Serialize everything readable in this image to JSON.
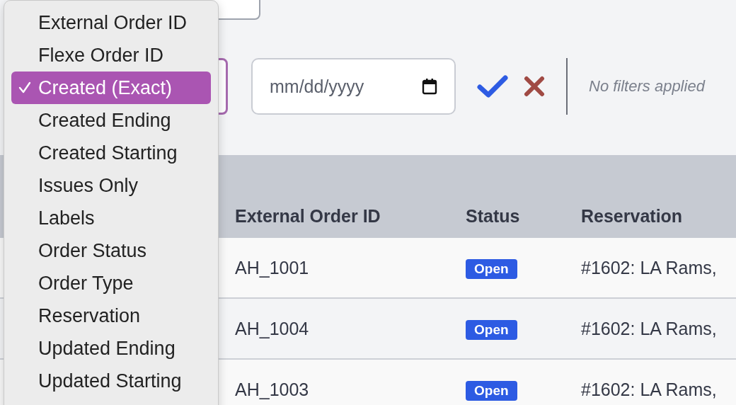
{
  "filter_bar": {
    "date_field": {
      "placeholder": "mm/dd/yyyy"
    },
    "status_text": "No filters applied"
  },
  "filter_menu": {
    "items": [
      {
        "label": "External Order ID",
        "selected": false
      },
      {
        "label": "Flexe Order ID",
        "selected": false
      },
      {
        "label": "Created (Exact)",
        "selected": true
      },
      {
        "label": "Created Ending",
        "selected": false
      },
      {
        "label": "Created Starting",
        "selected": false
      },
      {
        "label": "Issues Only",
        "selected": false
      },
      {
        "label": "Labels",
        "selected": false
      },
      {
        "label": "Order Status",
        "selected": false
      },
      {
        "label": "Order Type",
        "selected": false
      },
      {
        "label": "Reservation",
        "selected": false
      },
      {
        "label": "Updated Ending",
        "selected": false
      },
      {
        "label": "Updated Starting",
        "selected": false
      }
    ]
  },
  "table": {
    "columns": [
      "External Order ID",
      "Status",
      "Reservation"
    ],
    "rows": [
      {
        "external_order_id": "AH_1001",
        "status": "Open",
        "reservation": "#1602: LA Rams,"
      },
      {
        "external_order_id": "AH_1004",
        "status": "Open",
        "reservation": "#1602: LA Rams,"
      },
      {
        "external_order_id": "AH_1003",
        "status": "Open",
        "reservation": "#1602: LA Rams,"
      }
    ]
  }
}
